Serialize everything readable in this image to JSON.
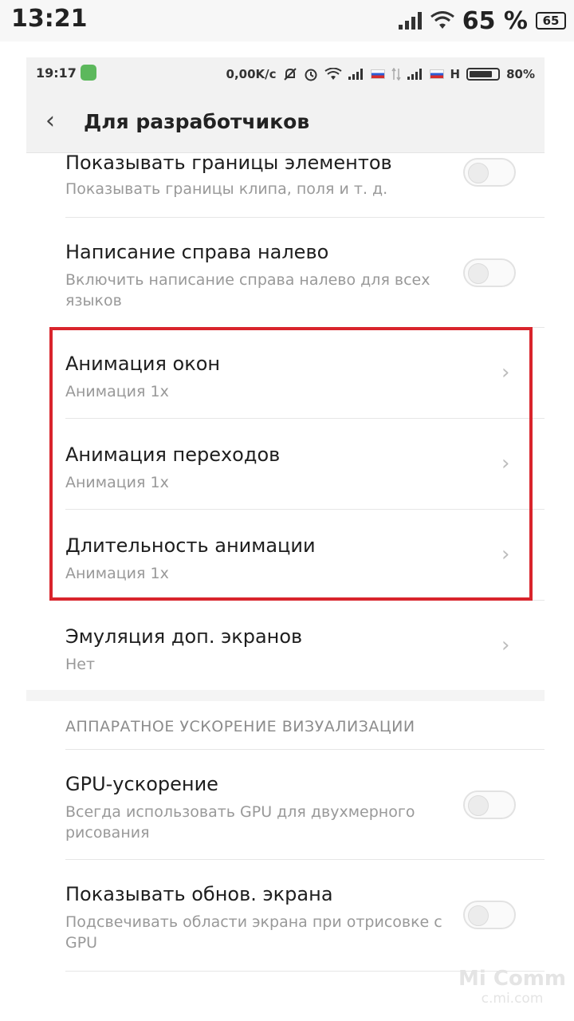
{
  "outer_status": {
    "time": "13:21",
    "battery_percent": "65 %",
    "battery_badge": "65"
  },
  "inner_status": {
    "time": "19:17",
    "speed": "0,00K/c",
    "network_h": "H",
    "battery": "80%"
  },
  "header": {
    "title": "Для разработчиков"
  },
  "items": [
    {
      "title": "Показывать границы элементов",
      "subtitle": "Показывать границы клипа, поля и т. д.",
      "toggle_on": false
    },
    {
      "title": "Написание справа налево",
      "subtitle": "Включить написание справа налево для всех языков",
      "toggle_on": false
    },
    {
      "title": "Анимация окон",
      "subtitle": "Анимация 1x"
    },
    {
      "title": "Анимация переходов",
      "subtitle": "Анимация 1x"
    },
    {
      "title": "Длительность анимации",
      "subtitle": "Анимация 1x"
    },
    {
      "title": "Эмуляция доп. экранов",
      "subtitle": "Нет"
    }
  ],
  "section": {
    "label": "АППАРАТНОЕ УСКОРЕНИЕ ВИЗУАЛИЗАЦИИ"
  },
  "hw_items": [
    {
      "title": "GPU-ускорение",
      "subtitle": "Всегда использовать GPU для двухмерного рисования",
      "toggle_on": false
    },
    {
      "title": "Показывать обнов. экрана",
      "subtitle": "Подсвечивать области экрана при отрисовке с GPU",
      "toggle_on": false
    }
  ],
  "watermark": {
    "line1": "Mi Comm",
    "line2": "c.mi.com"
  },
  "colors": {
    "highlight": "#d9242c",
    "header_bg": "#f2f2f2"
  }
}
